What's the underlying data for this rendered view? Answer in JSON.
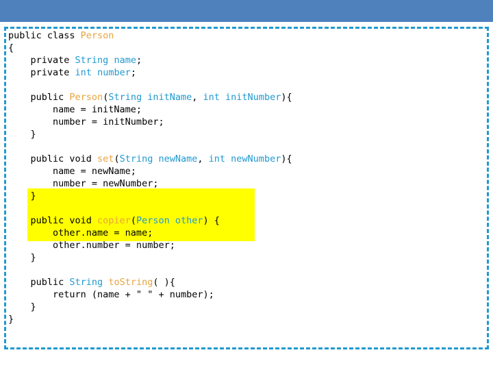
{
  "slide": {
    "top_band_color": "#4f81bd",
    "frame_border_color": "#1f99d0",
    "highlight_color": "#ffff00",
    "keyword_color": "#000000",
    "type_color": "#e8a33d",
    "identifier_color": "#1f99d0",
    "background_color": "#ffffff"
  },
  "code": {
    "language": "java",
    "lines": [
      {
        "id": "l1",
        "text": "public class Person"
      },
      {
        "id": "l2",
        "text": "{"
      },
      {
        "id": "l3",
        "text": "    private String name;"
      },
      {
        "id": "l4",
        "text": "    private int number;"
      },
      {
        "id": "l5",
        "text": ""
      },
      {
        "id": "l6",
        "text": "    public Person(String initName, int initNumber){"
      },
      {
        "id": "l7",
        "text": "        name = initName;"
      },
      {
        "id": "l8",
        "text": "        number = initNumber;"
      },
      {
        "id": "l9",
        "text": "    }"
      },
      {
        "id": "l10",
        "text": ""
      },
      {
        "id": "l11",
        "text": "    public void set(String newName, int newNumber){"
      },
      {
        "id": "l12",
        "text": "        name = newName;"
      },
      {
        "id": "l13",
        "text": "        number = newNumber;"
      },
      {
        "id": "l14",
        "text": "    }"
      },
      {
        "id": "l15",
        "text": ""
      },
      {
        "id": "l16",
        "text": "    public void copier(Person other) {"
      },
      {
        "id": "l17",
        "text": "        other.name = name;"
      },
      {
        "id": "l18",
        "text": "        other.number = number;"
      },
      {
        "id": "l19",
        "text": "    }"
      },
      {
        "id": "l20",
        "text": ""
      },
      {
        "id": "l21",
        "text": "    public String toString( ){"
      },
      {
        "id": "l22",
        "text": "        return (name + \" \" + number);"
      },
      {
        "id": "l23",
        "text": "    }"
      },
      {
        "id": "l24",
        "text": "}"
      }
    ],
    "tokens": {
      "l1": [
        {
          "t": "public class ",
          "c": "kw"
        },
        {
          "t": "Person",
          "c": "type"
        }
      ],
      "l2": [
        {
          "t": "{",
          "c": "plain"
        }
      ],
      "l3": [
        {
          "t": "    private ",
          "c": "kw"
        },
        {
          "t": "String ",
          "c": "blu"
        },
        {
          "t": "name",
          "c": "blu"
        },
        {
          "t": ";",
          "c": "plain"
        }
      ],
      "l4": [
        {
          "t": "    private ",
          "c": "kw"
        },
        {
          "t": "int ",
          "c": "blu"
        },
        {
          "t": "number",
          "c": "blu"
        },
        {
          "t": ";",
          "c": "plain"
        }
      ],
      "l5": [
        {
          "t": " ",
          "c": "plain"
        }
      ],
      "l6": [
        {
          "t": "    public ",
          "c": "kw"
        },
        {
          "t": "Person",
          "c": "type"
        },
        {
          "t": "(",
          "c": "plain"
        },
        {
          "t": "String ",
          "c": "blu"
        },
        {
          "t": "initName",
          "c": "blu"
        },
        {
          "t": ", ",
          "c": "plain"
        },
        {
          "t": "int ",
          "c": "blu"
        },
        {
          "t": "initNumber",
          "c": "blu"
        },
        {
          "t": "){",
          "c": "plain"
        }
      ],
      "l7": [
        {
          "t": "        name = initName;",
          "c": "plain"
        }
      ],
      "l8": [
        {
          "t": "        number = initNumber;",
          "c": "plain"
        }
      ],
      "l9": [
        {
          "t": "    }",
          "c": "plain"
        }
      ],
      "l10": [
        {
          "t": " ",
          "c": "plain"
        }
      ],
      "l11": [
        {
          "t": "    public void ",
          "c": "kw"
        },
        {
          "t": "set",
          "c": "type"
        },
        {
          "t": "(",
          "c": "plain"
        },
        {
          "t": "String ",
          "c": "blu"
        },
        {
          "t": "newName",
          "c": "blu"
        },
        {
          "t": ", ",
          "c": "plain"
        },
        {
          "t": "int ",
          "c": "blu"
        },
        {
          "t": "newNumber",
          "c": "blu"
        },
        {
          "t": "){",
          "c": "plain"
        }
      ],
      "l12": [
        {
          "t": "        name = newName;",
          "c": "plain"
        }
      ],
      "l13": [
        {
          "t": "        number = newNumber;",
          "c": "plain"
        }
      ],
      "l14": [
        {
          "t": "    }",
          "c": "plain"
        }
      ],
      "l15": [
        {
          "t": " ",
          "c": "plain"
        }
      ],
      "l16": [
        {
          "t": "    public void ",
          "c": "kw"
        },
        {
          "t": "copier",
          "c": "type"
        },
        {
          "t": "(",
          "c": "plain"
        },
        {
          "t": "Person ",
          "c": "blu"
        },
        {
          "t": "other",
          "c": "blu"
        },
        {
          "t": ") {",
          "c": "plain"
        }
      ],
      "l17": [
        {
          "t": "        other.name = name;",
          "c": "plain"
        }
      ],
      "l18": [
        {
          "t": "        other.number = number;",
          "c": "plain"
        }
      ],
      "l19": [
        {
          "t": "    }",
          "c": "plain"
        }
      ],
      "l20": [
        {
          "t": " ",
          "c": "plain"
        }
      ],
      "l21": [
        {
          "t": "    public ",
          "c": "kw"
        },
        {
          "t": "String ",
          "c": "blu"
        },
        {
          "t": "toString",
          "c": "type"
        },
        {
          "t": "( ){",
          "c": "plain"
        }
      ],
      "l22": [
        {
          "t": "        return (name + \" \" + number);",
          "c": "plain"
        }
      ],
      "l23": [
        {
          "t": "    }",
          "c": "plain"
        }
      ],
      "l24": [
        {
          "t": "}",
          "c": "plain"
        }
      ]
    },
    "highlighted_lines": [
      "l16",
      "l17",
      "l18",
      "l19"
    ]
  }
}
